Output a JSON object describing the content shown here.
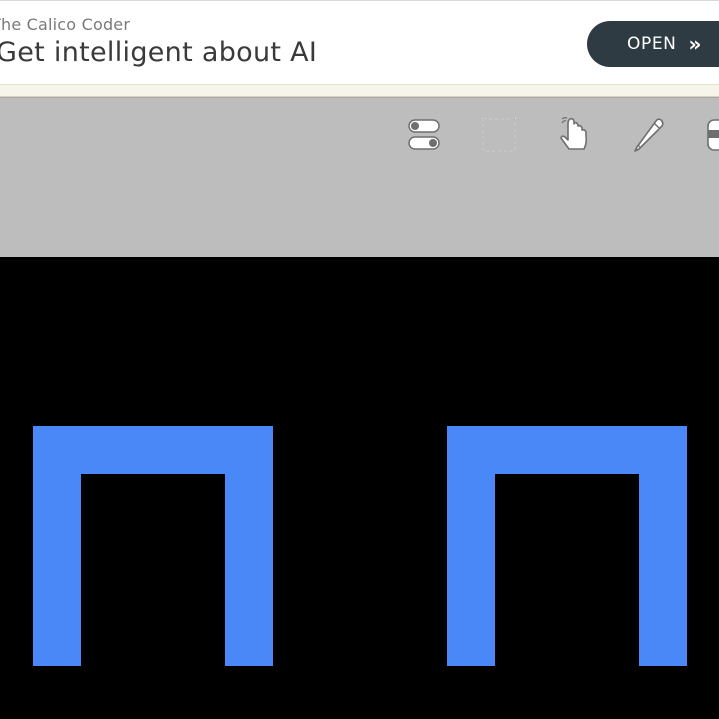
{
  "ad": {
    "source": "The Calico Coder",
    "title": "Get intelligent about AI",
    "open_label": "OPEN",
    "open_chevron": "»",
    "button_color": "#2f3b43"
  },
  "toolbar": {
    "background": "#bdbdbd",
    "tools": [
      {
        "name": "toggle-switches-icon"
      },
      {
        "name": "selection-marquee-icon"
      },
      {
        "name": "touch-hand-icon"
      },
      {
        "name": "pencil-icon"
      },
      {
        "name": "partial-tool-icon"
      }
    ]
  },
  "canvas": {
    "background": "#000000",
    "shape_color": "#4a88f7",
    "shapes": [
      {
        "name": "blue-arch-left"
      },
      {
        "name": "blue-arch-right"
      }
    ]
  }
}
